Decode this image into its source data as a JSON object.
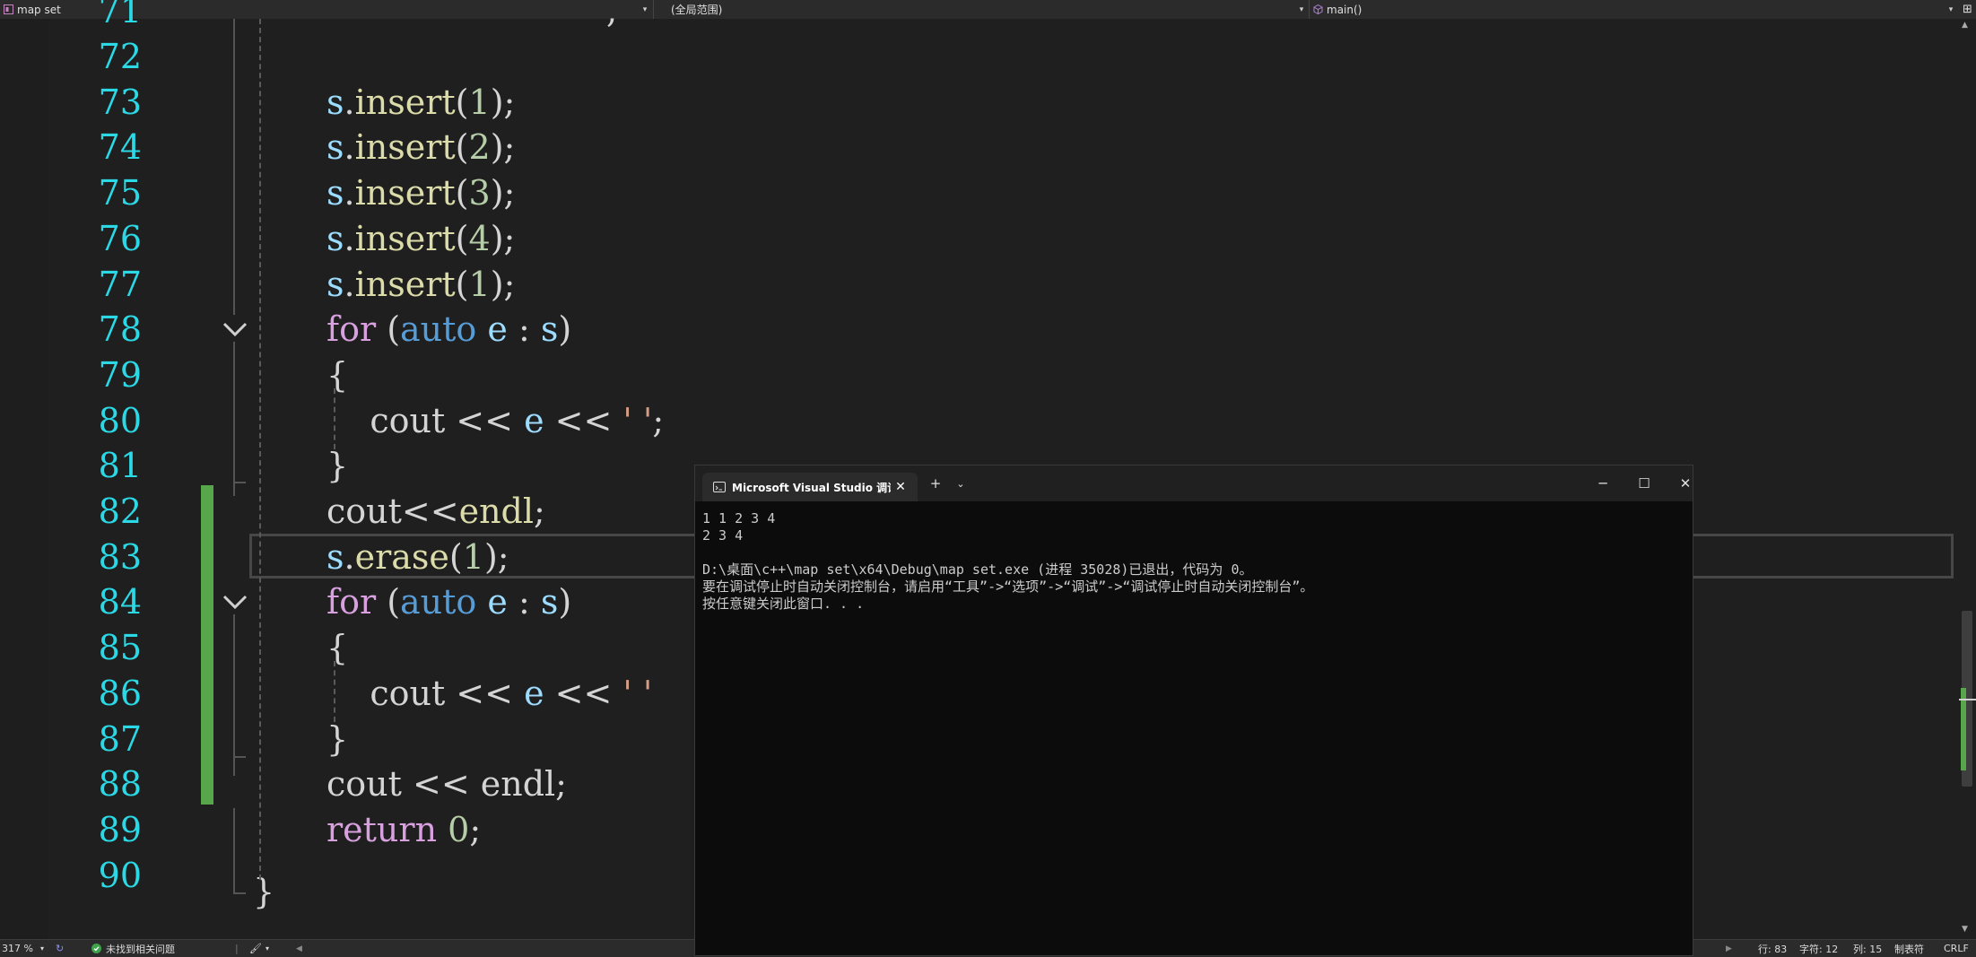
{
  "navbar": {
    "project": "map set",
    "scope": "(全局范围)",
    "member": "main()"
  },
  "editor": {
    "partial_line_number": "71",
    "partial_line_code": ",",
    "lines": [
      {
        "num": "72",
        "tokens": []
      },
      {
        "num": "73",
        "tokens": [
          {
            "c": "v",
            "t": "s"
          },
          {
            "c": "p",
            "t": "."
          },
          {
            "c": "f",
            "t": "insert"
          },
          {
            "c": "p",
            "t": "("
          },
          {
            "c": "n",
            "t": "1"
          },
          {
            "c": "p",
            "t": ");"
          }
        ]
      },
      {
        "num": "74",
        "tokens": [
          {
            "c": "v",
            "t": "s"
          },
          {
            "c": "p",
            "t": "."
          },
          {
            "c": "f",
            "t": "insert"
          },
          {
            "c": "p",
            "t": "("
          },
          {
            "c": "n",
            "t": "2"
          },
          {
            "c": "p",
            "t": ");"
          }
        ]
      },
      {
        "num": "75",
        "tokens": [
          {
            "c": "v",
            "t": "s"
          },
          {
            "c": "p",
            "t": "."
          },
          {
            "c": "f",
            "t": "insert"
          },
          {
            "c": "p",
            "t": "("
          },
          {
            "c": "n",
            "t": "3"
          },
          {
            "c": "p",
            "t": ");"
          }
        ]
      },
      {
        "num": "76",
        "tokens": [
          {
            "c": "v",
            "t": "s"
          },
          {
            "c": "p",
            "t": "."
          },
          {
            "c": "f",
            "t": "insert"
          },
          {
            "c": "p",
            "t": "("
          },
          {
            "c": "n",
            "t": "4"
          },
          {
            "c": "p",
            "t": ");"
          }
        ]
      },
      {
        "num": "77",
        "tokens": [
          {
            "c": "v",
            "t": "s"
          },
          {
            "c": "p",
            "t": "."
          },
          {
            "c": "f",
            "t": "insert"
          },
          {
            "c": "p",
            "t": "("
          },
          {
            "c": "n",
            "t": "1"
          },
          {
            "c": "p",
            "t": ");"
          }
        ]
      },
      {
        "num": "78",
        "tokens": [
          {
            "c": "k",
            "t": "for"
          },
          {
            "c": "p",
            "t": " ("
          },
          {
            "c": "t",
            "t": "auto"
          },
          {
            "c": "p",
            "t": " "
          },
          {
            "c": "v",
            "t": "e"
          },
          {
            "c": "p",
            "t": " : "
          },
          {
            "c": "v",
            "t": "s"
          },
          {
            "c": "p",
            "t": ")"
          }
        ]
      },
      {
        "num": "79",
        "tokens": [
          {
            "c": "p",
            "t": "{"
          }
        ]
      },
      {
        "num": "80",
        "tokens": [
          {
            "c": "p",
            "t": "    cout << "
          },
          {
            "c": "v",
            "t": "e"
          },
          {
            "c": "p",
            "t": " << "
          },
          {
            "c": "s",
            "t": "' '"
          },
          {
            "c": "p",
            "t": ";"
          }
        ]
      },
      {
        "num": "81",
        "tokens": [
          {
            "c": "p",
            "t": "}"
          }
        ]
      },
      {
        "num": "82",
        "tokens": [
          {
            "c": "p",
            "t": "cout<<"
          },
          {
            "c": "f",
            "t": "endl"
          },
          {
            "c": "p",
            "t": ";"
          }
        ]
      },
      {
        "num": "83",
        "tokens": [
          {
            "c": "v",
            "t": "s"
          },
          {
            "c": "p",
            "t": "."
          },
          {
            "c": "f",
            "t": "erase"
          },
          {
            "c": "p",
            "t": "("
          },
          {
            "c": "n",
            "t": "1"
          },
          {
            "c": "p",
            "t": ");"
          }
        ]
      },
      {
        "num": "84",
        "tokens": [
          {
            "c": "k",
            "t": "for"
          },
          {
            "c": "p",
            "t": " ("
          },
          {
            "c": "t",
            "t": "auto"
          },
          {
            "c": "p",
            "t": " "
          },
          {
            "c": "v",
            "t": "e"
          },
          {
            "c": "p",
            "t": " : "
          },
          {
            "c": "v",
            "t": "s"
          },
          {
            "c": "p",
            "t": ")"
          }
        ]
      },
      {
        "num": "85",
        "tokens": [
          {
            "c": "p",
            "t": "{"
          }
        ]
      },
      {
        "num": "86",
        "tokens": [
          {
            "c": "p",
            "t": "    cout << "
          },
          {
            "c": "v",
            "t": "e"
          },
          {
            "c": "p",
            "t": " << "
          },
          {
            "c": "s",
            "t": "' '"
          }
        ]
      },
      {
        "num": "87",
        "tokens": [
          {
            "c": "p",
            "t": "}"
          }
        ]
      },
      {
        "num": "88",
        "tokens": [
          {
            "c": "p",
            "t": "cout << endl;"
          }
        ]
      },
      {
        "num": "89",
        "tokens": [
          {
            "c": "k",
            "t": "return"
          },
          {
            "c": "p",
            "t": " "
          },
          {
            "c": "n",
            "t": "0"
          },
          {
            "c": "p",
            "t": ";"
          }
        ]
      },
      {
        "num": "90",
        "tokens": []
      }
    ],
    "closing_brace": "}"
  },
  "console": {
    "tab_title": "Microsoft Visual Studio 调试控制台",
    "new_tab": "+",
    "output": [
      "1 1 2 3 4",
      "2 3 4",
      "",
      "D:\\桌面\\c++\\map set\\x64\\Debug\\map set.exe (进程 35028)已退出，代码为 0。",
      "要在调试停止时自动关闭控制台，请启用“工具”->“选项”->“调试”->“调试停止时自动关闭控制台”。",
      "按任意键关闭此窗口. . ."
    ]
  },
  "statusbar": {
    "zoom": "317 %",
    "issues": "未找到相关问题",
    "line": "行: 83",
    "char": "字符: 12",
    "col": "列: 15",
    "indent": "制表符",
    "eol": "CRLF"
  },
  "colors": {
    "line_number": "#2bd9e6",
    "change_bar": "#57a64a",
    "keyword": "#d8a0df",
    "type": "#569cd6",
    "function": "#dcdcaa",
    "number": "#b5cea8",
    "string": "#d69d85"
  }
}
